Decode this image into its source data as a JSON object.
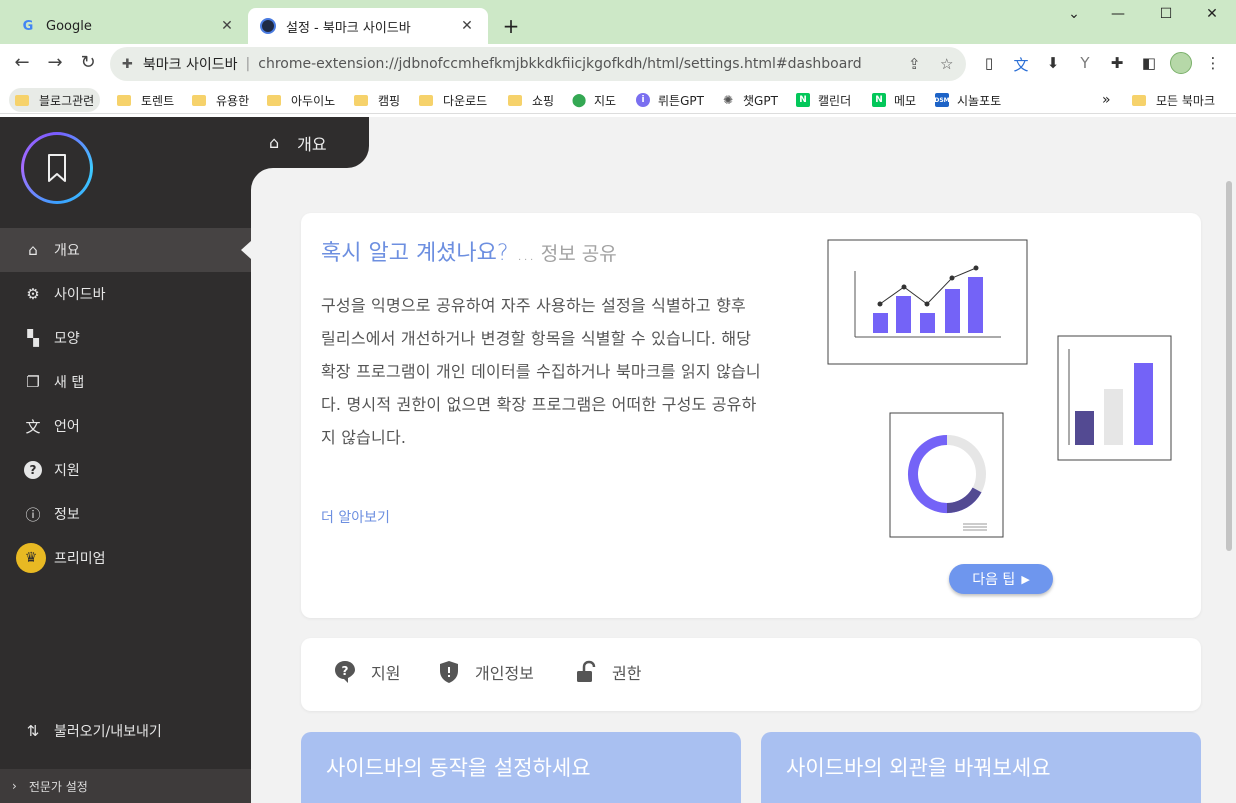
{
  "browser": {
    "tabs": [
      {
        "title": "Google",
        "favicon": "google-icon",
        "close": "✕"
      },
      {
        "title": "설정 - 북마크 사이드바",
        "favicon": "extension-icon",
        "close": "✕"
      }
    ],
    "new_tab": "+",
    "window_controls": {
      "dropdown": "⌄",
      "minimize": "—",
      "maximize": "☐",
      "close": "✕"
    },
    "nav": {
      "back": "←",
      "forward": "→",
      "reload": "↻"
    },
    "omnibox": {
      "site_name": "북마크 사이드바",
      "separator": "|",
      "url": "chrome-extension://jdbnofccmhefkmjbkkdkfiicjkgofkdh/html/settings.html#dashboard"
    },
    "bookmarks": [
      {
        "label": "블로그관련",
        "type": "folder"
      },
      {
        "label": "토렌트",
        "type": "folder"
      },
      {
        "label": "유용한",
        "type": "folder"
      },
      {
        "label": "아두이노",
        "type": "folder"
      },
      {
        "label": "캠핑",
        "type": "folder"
      },
      {
        "label": "다운로드",
        "type": "folder"
      },
      {
        "label": "쇼핑",
        "type": "folder"
      },
      {
        "label": "지도",
        "type": "maps"
      },
      {
        "label": "뤼튼GPT",
        "type": "wrtn"
      },
      {
        "label": "챗GPT",
        "type": "chatgpt"
      },
      {
        "label": "캘린더",
        "type": "naver"
      },
      {
        "label": "메모",
        "type": "naver"
      },
      {
        "label": "시놀포토",
        "type": "dsm"
      }
    ],
    "bookmarks_overflow": "»",
    "all_bookmarks": "모든 북마크"
  },
  "sidebar": {
    "items": [
      {
        "label": "개요",
        "icon": "home-icon",
        "glyph": "⌂"
      },
      {
        "label": "사이드바",
        "icon": "gear-icon",
        "glyph": "⚙"
      },
      {
        "label": "모양",
        "icon": "paint-roller-icon",
        "glyph": "▚"
      },
      {
        "label": "새 탭",
        "icon": "new-tab-icon",
        "glyph": "❐"
      },
      {
        "label": "언어",
        "icon": "translate-icon",
        "glyph": "文"
      },
      {
        "label": "지원",
        "icon": "help-icon",
        "glyph": "?"
      },
      {
        "label": "정보",
        "icon": "info-icon",
        "glyph": "ⓘ"
      },
      {
        "label": "프리미엄",
        "icon": "crown-icon",
        "glyph": "♛"
      }
    ],
    "import_export": {
      "label": "불러오기/내보내기",
      "glyph": "⇅"
    },
    "expert": {
      "label": "전문가 설정",
      "glyph": "›"
    }
  },
  "main": {
    "breadcrumb": {
      "label": "개요",
      "glyph": "⌂"
    },
    "tip": {
      "title": "혹시 알고 계셨나요?",
      "subtitle": "... 정보 공유",
      "body": "구성을 익명으로 공유하여 자주 사용하는 설정을 식별하고 향후 릴리스에서 개선하거나 변경할 항목을 식별할 수 있습니다. 해당 확장 프로그램이 개인 데이터를 수집하거나 북마크를 읽지 않습니다. 명시적 권한이 없으면 확장 프로그램은 어떠한 구성도 공유하지 않습니다.",
      "link": "더 알아보기",
      "next_button": "다음 팁",
      "next_arrow": "▶"
    },
    "quick_links": [
      {
        "label": "지원",
        "icon": "help-circle-icon"
      },
      {
        "label": "개인정보",
        "icon": "shield-icon"
      },
      {
        "label": "권한",
        "icon": "unlock-icon"
      }
    ],
    "features": [
      {
        "title": "사이드바의 동작을 설정하세요"
      },
      {
        "title": "사이드바의 외관을 바꿔보세요"
      }
    ]
  },
  "colors": {
    "sidebar_bg": "#2f2d2d",
    "accent": "#6e96ee",
    "chart_purple": "#7463f7",
    "chart_dark": "#534a92",
    "tabstrip": "#cde8c7"
  }
}
